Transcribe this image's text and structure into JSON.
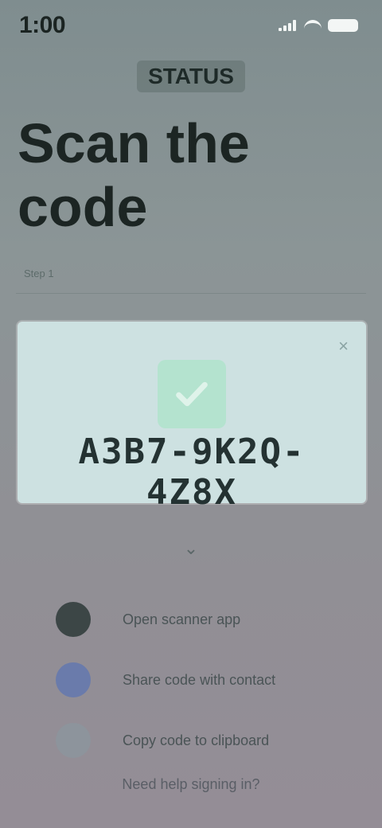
{
  "status_bar": {
    "time": "1:00"
  },
  "header": {
    "badge": "STATUS"
  },
  "hero": {
    "title": "Scan the code"
  },
  "section": {
    "caption": "Step 1"
  },
  "card": {
    "close_symbol": "×",
    "code": "A3B7-9K2Q-4Z8X"
  },
  "chevron_symbol": "⌄",
  "options": [
    {
      "icon": "dark-circle-icon",
      "label": "Open scanner app"
    },
    {
      "icon": "blue-circle-icon",
      "label": "Share code with contact"
    },
    {
      "icon": "gray-circle-icon",
      "label": "Copy code to clipboard"
    }
  ],
  "footer": {
    "link": "Need help signing in?"
  },
  "colors": {
    "accent_green": "#b4e3cf",
    "card_bg": "#cde1e1",
    "option_blue": "#6a7bab"
  }
}
